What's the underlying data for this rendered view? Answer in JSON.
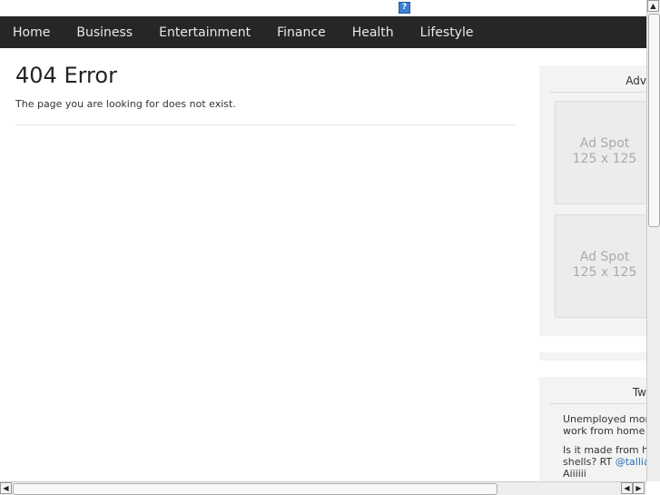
{
  "nav": {
    "items": [
      "Home",
      "Business",
      "Entertainment",
      "Finance",
      "Health",
      "Lifestyle"
    ]
  },
  "main": {
    "title": "404 Error",
    "message": "The page you are looking for does not exist."
  },
  "sidebar": {
    "ads_title": "Adv",
    "ads": [
      {
        "line1": "Ad Spot",
        "line2": "125 x 125"
      },
      {
        "line1": "Ad Spot",
        "line2": "125 x 125"
      }
    ],
    "twitter_title": "Tw",
    "tweets": [
      {
        "line1": "Unemployed moms",
        "line2": "work from home jol"
      },
      {
        "line1": "Is it made from hum",
        "line2_text": "shells? RT ",
        "line2_link": "@talliac",
        "line3": "Aiiiiii"
      }
    ]
  },
  "icons": {
    "help": "help-icon"
  }
}
